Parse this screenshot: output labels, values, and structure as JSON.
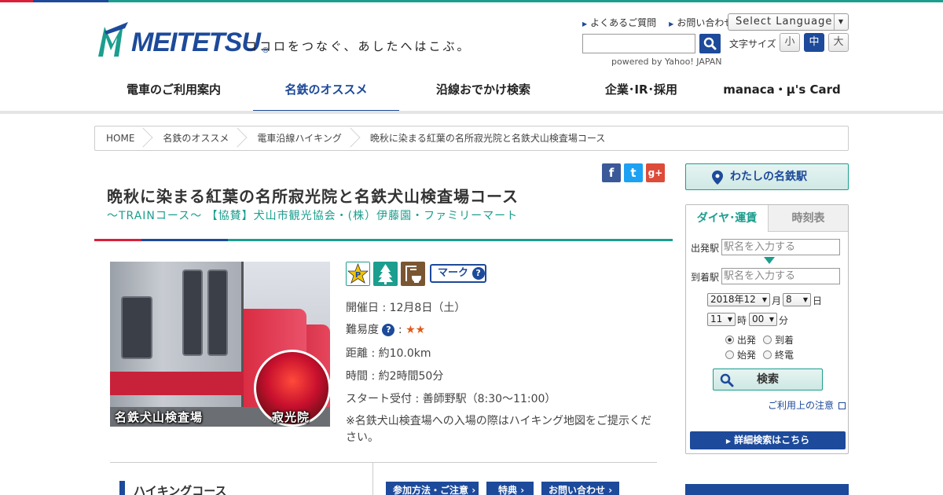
{
  "header": {
    "logo_text": "MEITETSU",
    "logo_reg": "®",
    "tagline": "ココロをつなぐ、あしたへはこぶ。",
    "links": [
      "よくあるご質問",
      "お問い合わせ"
    ],
    "language_label": "Select Language",
    "search_placeholder": "",
    "powered_by": "powered by Yahoo! JAPAN",
    "font_size_label": "文字サイズ",
    "font_sizes": [
      "小",
      "中",
      "大"
    ],
    "font_size_active": "中"
  },
  "nav": {
    "items": [
      "電車のご利用案内",
      "名鉄のオススメ",
      "沿線おでかけ検索",
      "企業･IR･採用",
      "manaca・μ's Card"
    ],
    "active": "名鉄のオススメ"
  },
  "breadcrumb": [
    "HOME",
    "名鉄のオススメ",
    "電車沿線ハイキング",
    "晩秋に染まる紅葉の名所寂光院と名鉄犬山検査場コース"
  ],
  "social": [
    "f",
    "t",
    "g+"
  ],
  "page": {
    "title": "晩秋に染まる紅葉の名所寂光院と名鉄犬山検査場コース",
    "subtitle": "～TRAINコース～ 【協賛】犬山市観光協会・(株）伊藤園・ファミリーマート"
  },
  "photo": {
    "label_left": "名鉄犬山検査場",
    "label_right": "寂光院"
  },
  "features": {
    "mark_label": "マーク",
    "info_icon": "?"
  },
  "details": {
    "date": "開催日 : 12月8日（土）",
    "difficulty_label": "難易度",
    "difficulty_sep": ":",
    "difficulty_stars": "★★",
    "distance": "距離 : 約10.0km",
    "time": "時間 : 約2時間50分",
    "start": "スタート受付 : 善師野駅（8:30～11:00）",
    "note": "※名鉄犬山検査場への入場の際はハイキング地図をご提示ください。"
  },
  "section": {
    "title": "ハイキングコース",
    "tabs": [
      "参加方法・ご注意",
      "特典",
      "お問い合わせ"
    ]
  },
  "sidebar": {
    "my_station": "わたしの名鉄駅",
    "tabs": [
      "ダイヤ･運賃",
      "時刻表"
    ],
    "from_label": "出発駅",
    "to_label": "到着駅",
    "from_placeholder": "駅名を入力する",
    "to_placeholder": "駅名を入力する",
    "year_month": "2018年12",
    "month_unit": "月",
    "day": "8",
    "day_unit": "日",
    "hour": "11",
    "hour_unit": "時",
    "minute": "00",
    "minute_unit": "分",
    "radios": [
      "出発",
      "到着",
      "始発",
      "終電"
    ],
    "radio_selected": "出発",
    "search_label": "検索",
    "notes_link": "ご利用上の注意",
    "detail_search": "詳細検索はこちら"
  },
  "colors": {
    "brand_blue": "#1d4a9a",
    "brand_teal": "#1b9e8e",
    "brand_red": "#d8203a",
    "facebook": "#3b5998",
    "twitter": "#1da1f2",
    "googleplus": "#dd4b39"
  }
}
